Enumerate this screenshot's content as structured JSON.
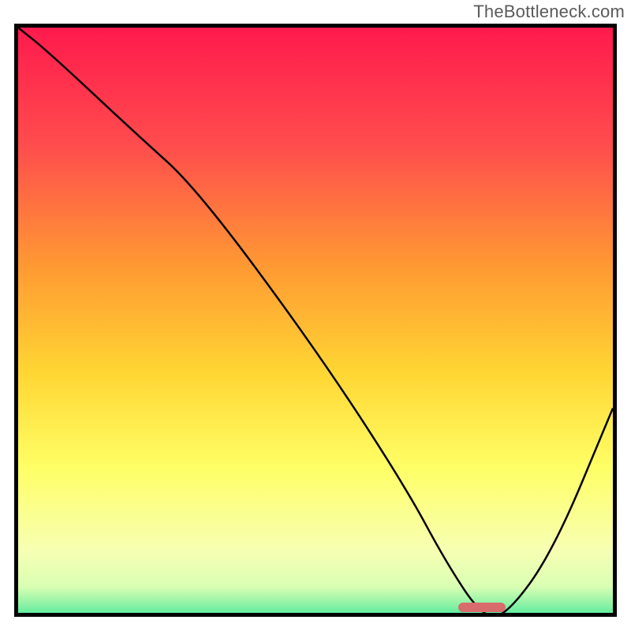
{
  "watermark": "TheBottleneck.com",
  "chart_data": {
    "type": "line",
    "title": "",
    "xlabel": "",
    "ylabel": "",
    "xlim": [
      0,
      100
    ],
    "ylim": [
      0,
      100
    ],
    "grid": false,
    "series": [
      {
        "name": "bottleneck-curve",
        "x": [
          0,
          5,
          20,
          30,
          50,
          65,
          72,
          78,
          82,
          90,
          100
        ],
        "y": [
          100,
          96,
          82,
          73,
          46,
          23,
          10,
          1,
          1,
          12,
          36
        ]
      }
    ],
    "marker": {
      "x_start": 74,
      "x_end": 82,
      "y": 1
    },
    "gradient_stops": [
      {
        "pos": 0.0,
        "color": "#ff1a4d"
      },
      {
        "pos": 0.2,
        "color": "#ff4d4d"
      },
      {
        "pos": 0.4,
        "color": "#ff9933"
      },
      {
        "pos": 0.58,
        "color": "#ffd633"
      },
      {
        "pos": 0.74,
        "color": "#ffff66"
      },
      {
        "pos": 0.88,
        "color": "#f7ffb3"
      },
      {
        "pos": 0.94,
        "color": "#d9ffb3"
      },
      {
        "pos": 0.97,
        "color": "#8cf2a6"
      },
      {
        "pos": 1.0,
        "color": "#33e699"
      }
    ]
  }
}
